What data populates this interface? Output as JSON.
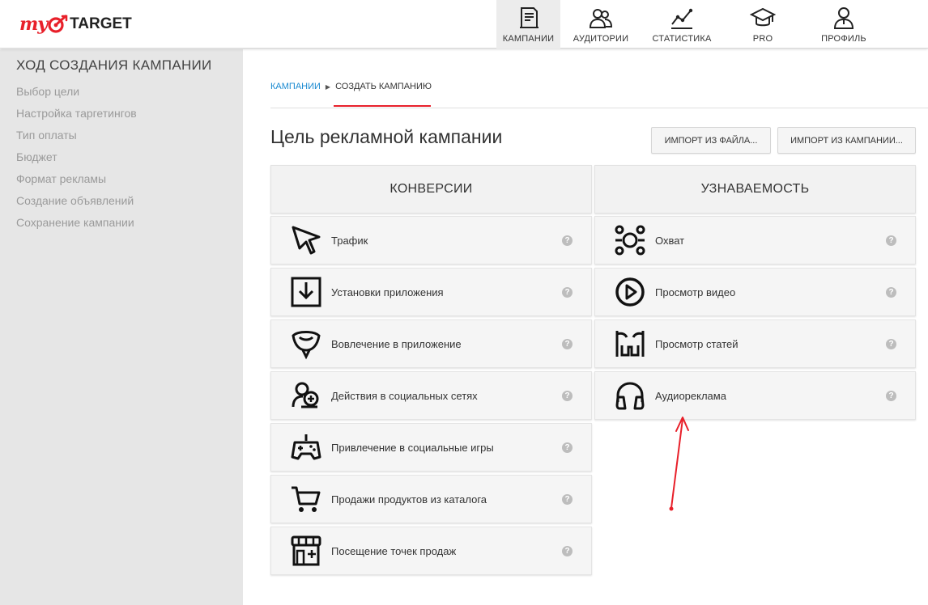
{
  "logo": {
    "my": "my",
    "target": "TARGET"
  },
  "nav": [
    {
      "label": "КАМПАНИИ",
      "icon": "campaigns-icon",
      "active": true
    },
    {
      "label": "АУДИТОРИИ",
      "icon": "audiences-icon"
    },
    {
      "label": "СТАТИСТИКА",
      "icon": "statistics-icon"
    },
    {
      "label": "PRO",
      "icon": "graduation-cap-icon"
    },
    {
      "label": "ПРОФИЛЬ",
      "icon": "profile-icon"
    }
  ],
  "sidebar": {
    "title": "ХОД СОЗДАНИЯ КАМПАНИИ",
    "items": [
      "Выбор цели",
      "Настройка таргетингов",
      "Тип оплаты",
      "Бюджет",
      "Формат рекламы",
      "Создание объявлений",
      "Сохранение кампании"
    ]
  },
  "breadcrumbs": {
    "link": "КАМПАНИИ",
    "current": "СОЗДАТЬ КАМПАНИЮ"
  },
  "page_title": "Цель рекламной кампании",
  "buttons": {
    "import_file": "ИМПОРТ ИЗ ФАЙЛА...",
    "import_campaign": "ИМПОРТ ИЗ КАМПАНИИ..."
  },
  "columns": {
    "conversions": {
      "title": "КОНВЕРСИИ",
      "items": [
        {
          "label": "Трафик",
          "icon": "cursor-icon"
        },
        {
          "label": "Установки приложения",
          "icon": "download-icon"
        },
        {
          "label": "Вовлечение в приложение",
          "icon": "engagement-icon"
        },
        {
          "label": "Действия в социальных сетях",
          "icon": "social-icon"
        },
        {
          "label": "Привлечение в социальные игры",
          "icon": "gamepad-icon"
        },
        {
          "label": "Продажи продуктов из каталога",
          "icon": "cart-icon"
        },
        {
          "label": "Посещение точек продаж",
          "icon": "store-icon"
        }
      ]
    },
    "awareness": {
      "title": "УЗНАВАЕМОСТЬ",
      "items": [
        {
          "label": "Охват",
          "icon": "reach-icon"
        },
        {
          "label": "Просмотр видео",
          "icon": "play-icon"
        },
        {
          "label": "Просмотр статей",
          "icon": "articles-icon"
        },
        {
          "label": "Аудиореклама",
          "icon": "headphones-icon"
        }
      ]
    }
  },
  "help_glyph": "?",
  "colors": {
    "accent": "#e8202a",
    "link": "#1a8ad1",
    "sidebar_bg": "#e6e6e6"
  }
}
